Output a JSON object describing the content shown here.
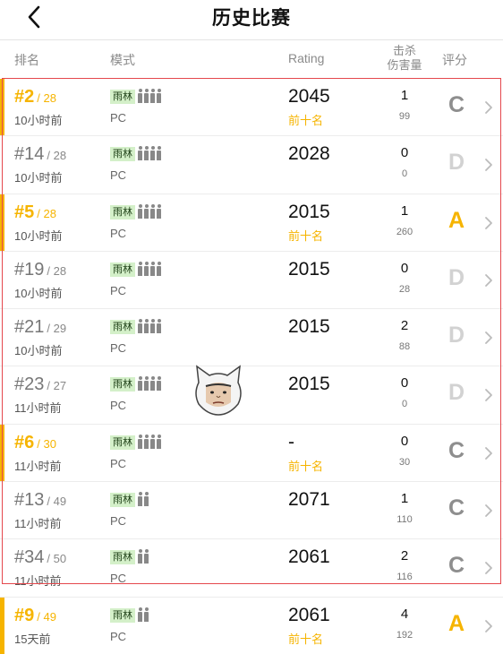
{
  "header": {
    "title": "历史比赛",
    "back_icon": "back-chevron-icon"
  },
  "columns": {
    "rank": "排名",
    "mode": "模式",
    "rating": "Rating",
    "kills": "击杀",
    "damage": "伤害量",
    "score": "评分"
  },
  "matches": [
    {
      "rank": "#2",
      "total": "/ 28",
      "time": "10小时前",
      "map": "雨林",
      "team_size": 4,
      "platform": "PC",
      "rating": "2045",
      "top10": "前十名",
      "kills": "1",
      "damage": "99",
      "grade": "C",
      "highlight": true
    },
    {
      "rank": "#14",
      "total": "/ 28",
      "time": "10小时前",
      "map": "雨林",
      "team_size": 4,
      "platform": "PC",
      "rating": "2028",
      "top10": "",
      "kills": "0",
      "damage": "0",
      "grade": "D",
      "highlight": false
    },
    {
      "rank": "#5",
      "total": "/ 28",
      "time": "10小时前",
      "map": "雨林",
      "team_size": 4,
      "platform": "PC",
      "rating": "2015",
      "top10": "前十名",
      "kills": "1",
      "damage": "260",
      "grade": "A",
      "highlight": true
    },
    {
      "rank": "#19",
      "total": "/ 28",
      "time": "10小时前",
      "map": "雨林",
      "team_size": 4,
      "platform": "PC",
      "rating": "2015",
      "top10": "",
      "kills": "0",
      "damage": "28",
      "grade": "D",
      "highlight": false
    },
    {
      "rank": "#21",
      "total": "/ 29",
      "time": "10小时前",
      "map": "雨林",
      "team_size": 4,
      "platform": "PC",
      "rating": "2015",
      "top10": "",
      "kills": "2",
      "damage": "88",
      "grade": "D",
      "highlight": false
    },
    {
      "rank": "#23",
      "total": "/ 27",
      "time": "11小时前",
      "map": "雨林",
      "team_size": 4,
      "platform": "PC",
      "rating": "2015",
      "top10": "",
      "kills": "0",
      "damage": "0",
      "grade": "D",
      "highlight": false
    },
    {
      "rank": "#6",
      "total": "/ 30",
      "time": "11小时前",
      "map": "雨林",
      "team_size": 4,
      "platform": "PC",
      "rating": "-",
      "top10": "前十名",
      "kills": "0",
      "damage": "30",
      "grade": "C",
      "highlight": true
    },
    {
      "rank": "#13",
      "total": "/ 49",
      "time": "11小时前",
      "map": "雨林",
      "team_size": 2,
      "platform": "PC",
      "rating": "2071",
      "top10": "",
      "kills": "1",
      "damage": "110",
      "grade": "C",
      "highlight": false
    },
    {
      "rank": "#34",
      "total": "/ 50",
      "time": "11小时前",
      "map": "雨林",
      "team_size": 2,
      "platform": "PC",
      "rating": "2061",
      "top10": "",
      "kills": "2",
      "damage": "116",
      "grade": "C",
      "highlight": false
    },
    {
      "rank": "#9",
      "total": "/ 49",
      "time": "15天前",
      "map": "雨林",
      "team_size": 2,
      "platform": "PC",
      "rating": "2061",
      "top10": "前十名",
      "kills": "4",
      "damage": "192",
      "grade": "A",
      "highlight": true
    }
  ],
  "colors": {
    "accent": "#f6b400",
    "grade_C": "#8e8e8e",
    "grade_D": "#d2d2d2",
    "grade_A": "#f6b400",
    "selection_box": "#e5484d"
  }
}
